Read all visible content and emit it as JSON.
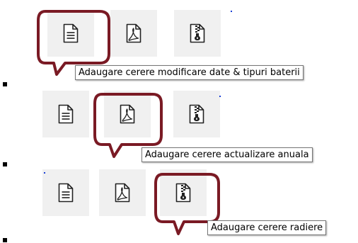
{
  "groups": [
    {
      "tooltip": "Adaugare cerere modificare date & tipuri baterii",
      "active": "document"
    },
    {
      "tooltip": "Adaugare cerere actualizare anuala",
      "active": "pdf"
    },
    {
      "tooltip": "Adaugare cerere radiere",
      "active": "zip"
    }
  ],
  "icons": [
    "document-icon",
    "pdf-icon",
    "zip-icon"
  ],
  "colors": {
    "highlight": "#7a1a24",
    "button_bg": "#f0f0f0",
    "tooltip_border": "#767676",
    "bullet": "#000000"
  }
}
